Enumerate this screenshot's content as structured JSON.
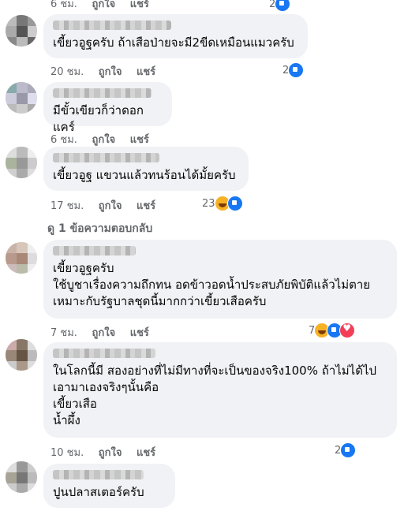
{
  "actions": {
    "like": "ถูกใจ",
    "reply": "แชร์"
  },
  "comments": [
    {
      "time": "6 ชม.",
      "text": "",
      "reactions": "2"
    },
    {
      "time": "20 ชม.",
      "text": "เขี้ยวอูฐครับ  ถ้าเสือป่ายจะมี2ขีดเหมือนแมวครับ",
      "reactions": "2"
    },
    {
      "time": "6 ชม.",
      "text": "มีขั้วเขียวก็ว่าดอกแคร์",
      "reactions": ""
    },
    {
      "time": "17 ชม.",
      "text": "เขี้ยวอูฐ แขวนแล้วทนร้อนได้มั้ยครับ",
      "reactions": "23"
    },
    {
      "time": "7 ชม.",
      "text": "เขี้ยวอูฐครับ\nใช้บูชาเรื่องความถึกทน อดข้าวอดน้ำประสบภัยพิบัติแล้วไม่ตาย\nเหมาะกับรัฐบาลชุดนี้มากกว่าเขี้ยวเสือครับ",
      "reactions": "7"
    },
    {
      "time": "10 ชม.",
      "text": "ในโลกนี้มี สองอย่างที่ไม่มีทางที่จะเป็นของจริง100% ถ้าไม่ได้ไป\nเอามาเองจริงๆนั้นคือ\nเขี้ยวเสือ\nน้ำผึ้ง",
      "reactions": "2"
    },
    {
      "time": "",
      "text": "ปูนปลาสเตอร์ครับ",
      "reactions": ""
    }
  ],
  "view_replies": "ดู 1 ข้อความตอบกลับ"
}
